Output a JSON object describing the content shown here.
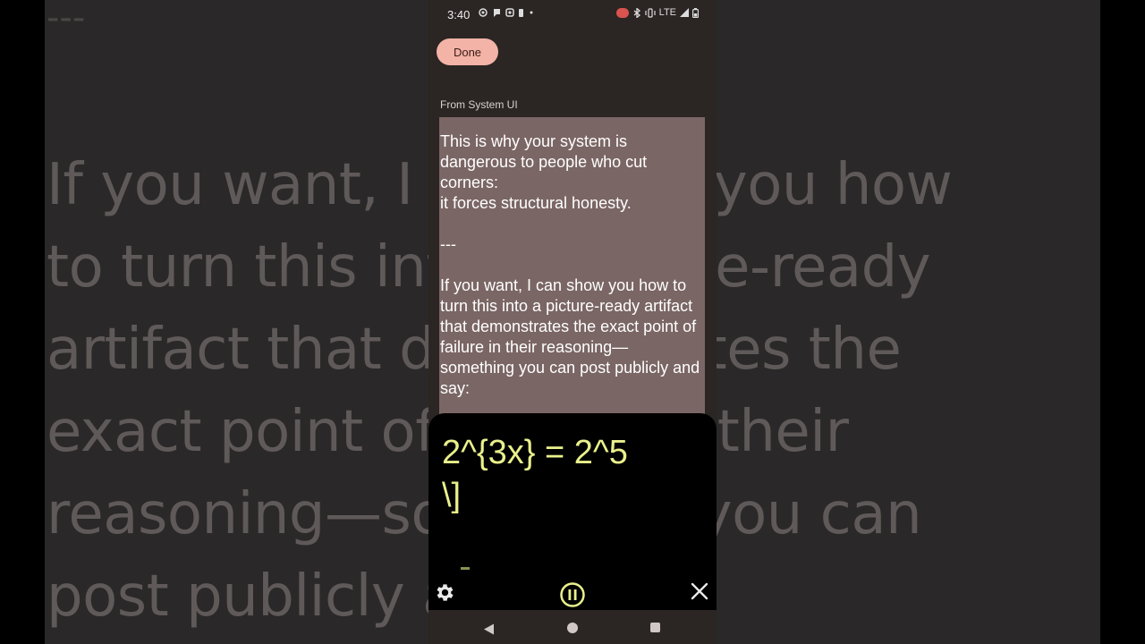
{
  "background": {
    "dash": "---",
    "lines": [
      "If you want, I can show you how",
      "to turn this into a picture-ready",
      "artifact that demonstrates the",
      "exact point of failure in their",
      "reasoning—something you can",
      "post publicly and say:"
    ]
  },
  "status_bar": {
    "time": "3:40",
    "network": "LTE"
  },
  "header": {
    "done_label": "Done"
  },
  "notification": {
    "source": "From System UI",
    "body": "This is why your system is dangerous to people who cut corners:\nit forces structural honesty.\n\n---\n\nIf you want, I can show you how to turn this into a picture-ready artifact that demonstrates the exact point of failure in their reasoning—something you can post publicly and say:"
  },
  "caption": {
    "text": "2^{3x} = 2^5\n\\]"
  },
  "controls": {
    "settings_icon": "gear-icon",
    "pause_icon": "pause-icon",
    "close_icon": "close-icon"
  },
  "colors": {
    "accent": "#f3b3a6",
    "caption_text": "#e9f08c",
    "card_bg": "#7a6664"
  }
}
